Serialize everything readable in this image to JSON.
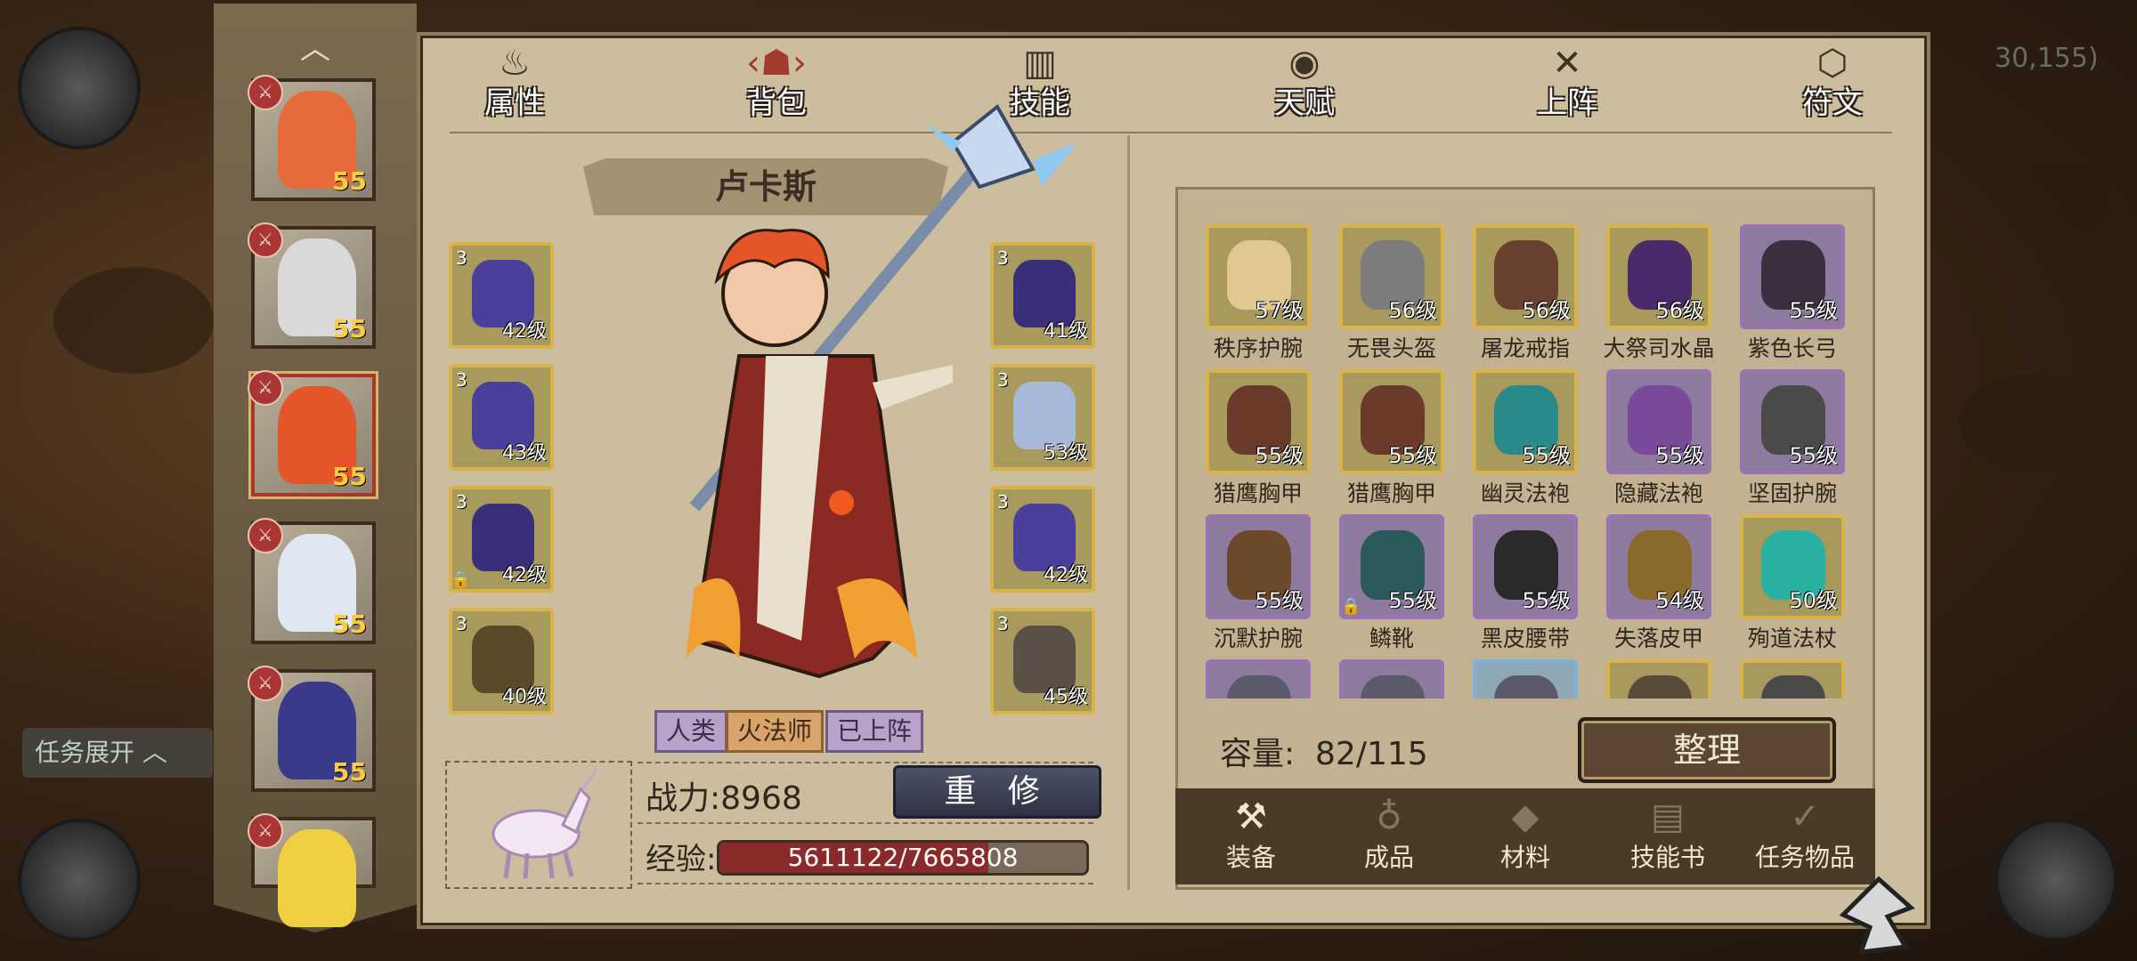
{
  "tabs": [
    {
      "label": "属性",
      "icon": "flame-icon",
      "active": false
    },
    {
      "label": "背包",
      "icon": "backpack-icon",
      "active": true
    },
    {
      "label": "技能",
      "icon": "book-icon",
      "active": false
    },
    {
      "label": "天赋",
      "icon": "eye-icon",
      "active": false
    },
    {
      "label": "上阵",
      "icon": "crossed-swords-icon",
      "active": false
    },
    {
      "label": "符文",
      "icon": "rune-icon",
      "active": false
    }
  ],
  "hero_list": [
    {
      "level": "55",
      "badge": "sword-icon",
      "selected": false
    },
    {
      "level": "55",
      "badge": "sword-icon",
      "selected": false
    },
    {
      "level": "55",
      "badge": "staff-icon",
      "selected": true
    },
    {
      "level": "55",
      "badge": "sword-icon",
      "selected": false
    },
    {
      "level": "55",
      "badge": "sword-icon",
      "selected": false
    },
    {
      "level": "",
      "badge": "sword-icon",
      "selected": false
    }
  ],
  "hero": {
    "name": "卢卡斯",
    "tags": [
      "人类",
      "火法师",
      "已上阵"
    ],
    "power": "战力:8968",
    "rebuild_label": "重 修",
    "exp_label": "经验:",
    "exp_text": "5611122/7665808",
    "exp_fraction": 0.732
  },
  "equipment_left": [
    {
      "count": "3",
      "level": "42级",
      "locked": false,
      "color": "#4a3f9a"
    },
    {
      "count": "3",
      "level": "43级",
      "locked": false,
      "color": "#4a3f9a"
    },
    {
      "count": "3",
      "level": "42级",
      "locked": true,
      "color": "#3a2f7a"
    },
    {
      "count": "3",
      "level": "40级",
      "locked": false,
      "color": "#5a4a2a"
    }
  ],
  "equipment_right": [
    {
      "count": "3",
      "level": "41级",
      "locked": false,
      "color": "#3a2f7a"
    },
    {
      "count": "3",
      "level": "53级",
      "locked": false,
      "color": "#a8b8d8"
    },
    {
      "count": "3",
      "level": "42级",
      "locked": false,
      "color": "#4a3f9a"
    },
    {
      "count": "3",
      "level": "45级",
      "locked": false,
      "color": "#5a5048"
    }
  ],
  "inventory": [
    {
      "name": "秩序护腕",
      "level": "57级",
      "rarity": "gold",
      "color": "#e0c890"
    },
    {
      "name": "无畏头盔",
      "level": "56级",
      "rarity": "gold",
      "color": "#7c7c7c"
    },
    {
      "name": "屠龙戒指",
      "level": "56级",
      "rarity": "gold",
      "color": "#6a4030"
    },
    {
      "name": "大祭司水晶",
      "level": "56级",
      "rarity": "gold",
      "color": "#4a2a6a"
    },
    {
      "name": "紫色长弓",
      "level": "55级",
      "rarity": "purple",
      "color": "#3a3040"
    },
    {
      "name": "猎鹰胸甲",
      "level": "55级",
      "rarity": "gold",
      "color": "#6a3a2a"
    },
    {
      "name": "猎鹰胸甲",
      "level": "55级",
      "rarity": "gold",
      "color": "#6a3a2a"
    },
    {
      "name": "幽灵法袍",
      "level": "55级",
      "rarity": "gold",
      "color": "#2a8a8a"
    },
    {
      "name": "隐藏法袍",
      "level": "55级",
      "rarity": "purple",
      "color": "#7a4a9a"
    },
    {
      "name": "坚固护腕",
      "level": "55级",
      "rarity": "purple",
      "color": "#4a4a4a"
    },
    {
      "name": "沉默护腕",
      "level": "55级",
      "rarity": "purple",
      "color": "#6a4a2a"
    },
    {
      "name": "鳞靴",
      "level": "55级",
      "rarity": "purple",
      "color": "#2a5a5a",
      "locked": true
    },
    {
      "name": "黑皮腰带",
      "level": "55级",
      "rarity": "purple",
      "color": "#2a2a2a"
    },
    {
      "name": "失落皮甲",
      "level": "54级",
      "rarity": "purple",
      "color": "#8a6a2a"
    },
    {
      "name": "殉道法杖",
      "level": "50级",
      "rarity": "gold",
      "color": "#2ab0a0"
    },
    {
      "name": "",
      "level": "",
      "rarity": "purple",
      "color": "#5a5a6a"
    },
    {
      "name": "",
      "level": "",
      "rarity": "purple",
      "color": "#5a5a6a"
    },
    {
      "name": "",
      "level": "",
      "rarity": "blue",
      "color": "#5a5a6a"
    },
    {
      "name": "",
      "level": "",
      "rarity": "gold",
      "color": "#5a4a3a"
    },
    {
      "name": "",
      "level": "",
      "rarity": "gold",
      "color": "#4a4a4a"
    }
  ],
  "capacity": {
    "label": "容量:",
    "value": "82/115"
  },
  "sort_label": "整理",
  "categories": [
    {
      "label": "装备",
      "icon": "hammer-icon",
      "active": true
    },
    {
      "label": "成品",
      "icon": "pouch-icon",
      "active": false
    },
    {
      "label": "材料",
      "icon": "ore-icon",
      "active": false
    },
    {
      "label": "技能书",
      "icon": "scroll-icon",
      "active": false
    },
    {
      "label": "任务物品",
      "icon": "quest-scroll-icon",
      "active": false
    }
  ],
  "background": {
    "task_toggle": "任务展开",
    "coords": "30,155)"
  }
}
